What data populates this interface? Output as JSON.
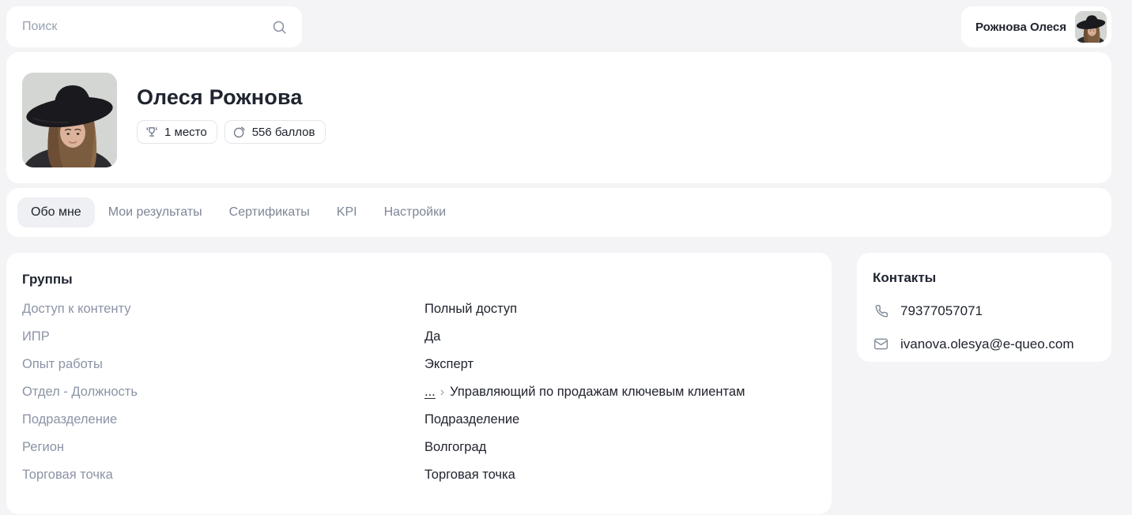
{
  "colors": {
    "page_bg": "#f4f4f6",
    "card_bg": "#ffffff",
    "text_dark": "#20242e",
    "text_muted": "#8b93a5",
    "tab_inactive": "#7d8696",
    "active_tab_bg": "#eef0f3",
    "badge_border": "#e3e6eb",
    "icon_gray": "#868e9c"
  },
  "topbar": {
    "search": {
      "placeholder": "Поиск",
      "icon": "search-icon"
    },
    "user": {
      "name": "Рожнова Олеся",
      "avatar": "user-avatar-photo"
    }
  },
  "profile": {
    "name": "Олеся Рожнова",
    "avatar": "user-avatar-photo",
    "badges": [
      {
        "icon": "trophy-icon",
        "label": "1 место"
      },
      {
        "icon": "coin-icon",
        "label": "556 баллов"
      }
    ]
  },
  "tabs": [
    {
      "label": "Обо мне",
      "active": true
    },
    {
      "label": "Мои результаты",
      "active": false
    },
    {
      "label": "Сертификаты",
      "active": false
    },
    {
      "label": "KPI",
      "active": false
    },
    {
      "label": "Настройки",
      "active": false
    }
  ],
  "groups": {
    "title": "Группы",
    "rows": [
      {
        "label": "Доступ к контенту",
        "value": "Полный доступ"
      },
      {
        "label": "ИПР",
        "value": "Да"
      },
      {
        "label": "Опыт работы",
        "value": "Эксперт"
      },
      {
        "label": "Отдел - Должность",
        "link_label": "...",
        "chevron": "›",
        "value": "Управляющий по продажам ключевым клиентам"
      },
      {
        "label": "Подразделение",
        "value": "Подразделение"
      },
      {
        "label": "Регион",
        "value": "Волгоград"
      },
      {
        "label": "Торговая точка",
        "value": "Торговая точка"
      }
    ]
  },
  "contacts": {
    "title": "Контакты",
    "items": [
      {
        "icon": "phone-icon",
        "value": "79377057071"
      },
      {
        "icon": "mail-icon",
        "value": "ivanova.olesya@e-queo.com"
      }
    ]
  }
}
